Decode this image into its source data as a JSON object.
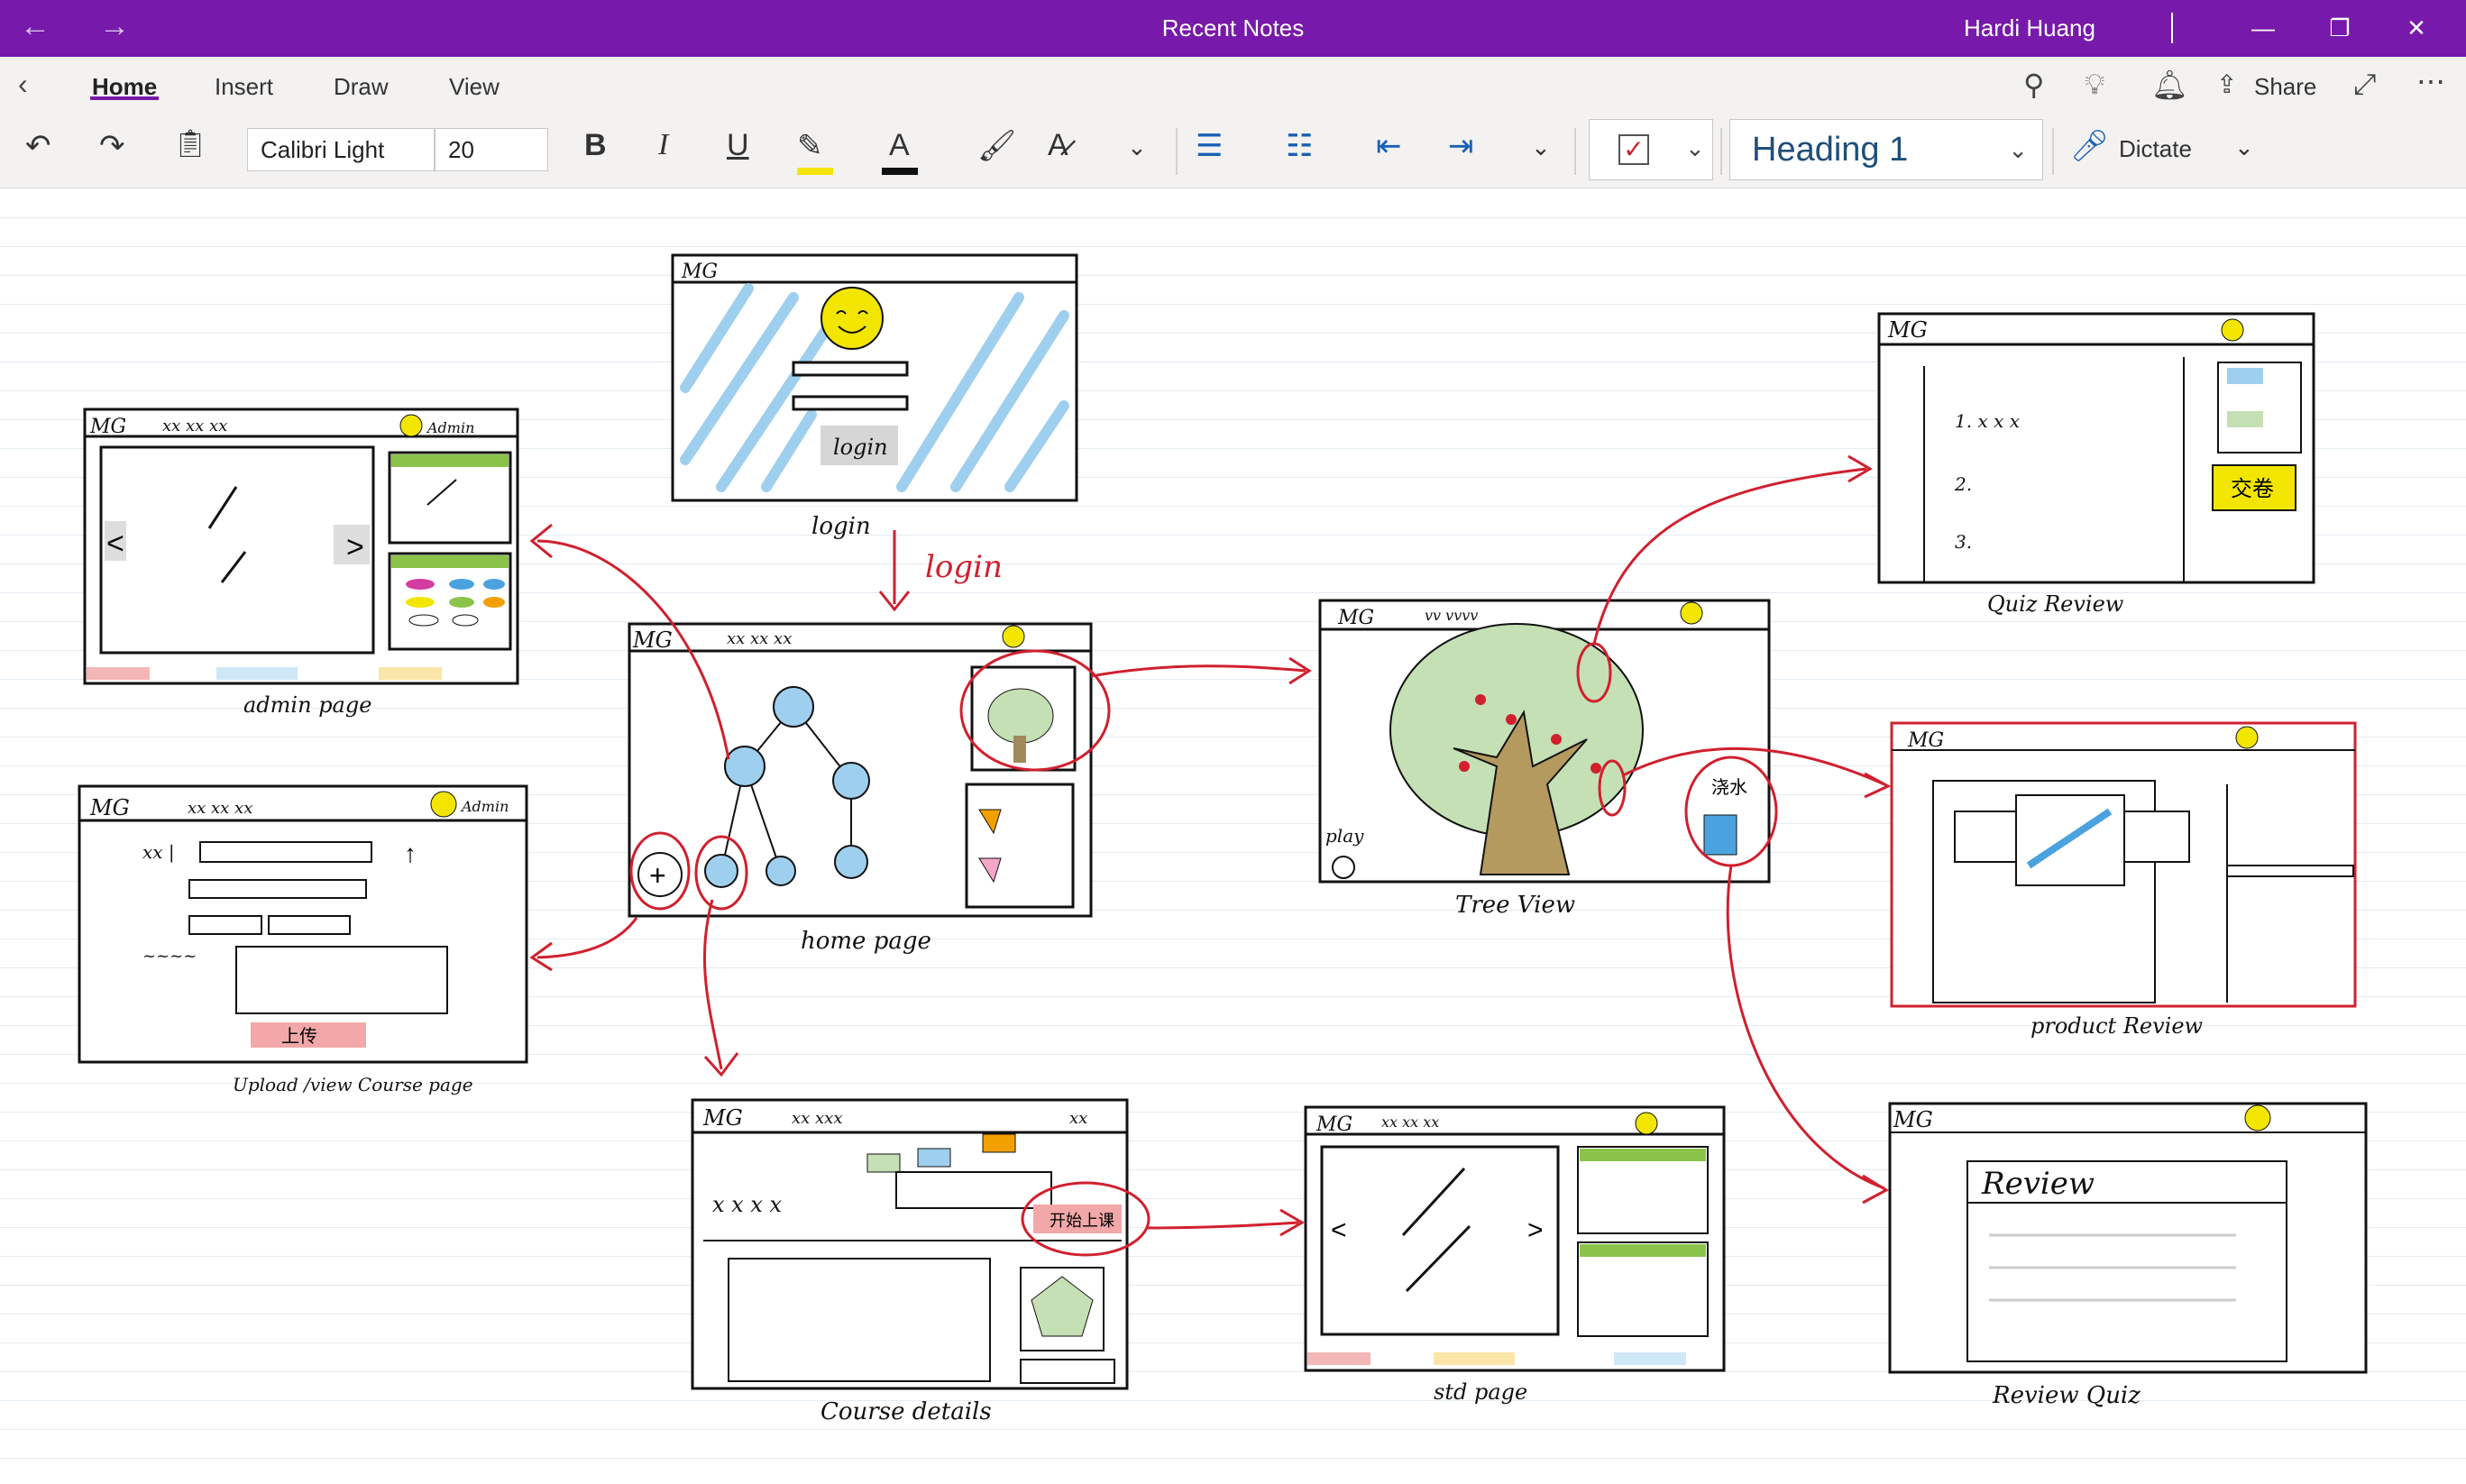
{
  "window": {
    "title": "Recent Notes",
    "user": "Hardi Huang",
    "back_icon": "back-arrow-icon",
    "forward_icon": "forward-arrow-icon"
  },
  "tabs": [
    {
      "label": "Home",
      "active": true
    },
    {
      "label": "Insert",
      "active": false
    },
    {
      "label": "Draw",
      "active": false
    },
    {
      "label": "View",
      "active": false
    }
  ],
  "top_right": {
    "share_label": "Share"
  },
  "ribbon": {
    "font_family": "Calibri Light",
    "font_size": "20",
    "bold": "B",
    "italic": "I",
    "underline": "U",
    "font_color_glyph": "A",
    "style": "Heading 1",
    "dictate_label": "Dictate"
  },
  "colors": {
    "titlebar": "#7719AA",
    "ink_red": "#d0202e",
    "ink_black": "#111111",
    "sketch_blue": "#9fcfee",
    "sketch_yellow": "#f2e600",
    "sketch_green": "#8bc34a"
  },
  "sketches": {
    "login_label": "login",
    "login_arrow_label": "login",
    "login_button": "login",
    "admin_label": "admin page",
    "admin_badge": "Admin",
    "upload_label": "Upload /view Course page",
    "upload_badge": "Admin",
    "upload_button": "上传",
    "home_label": "home page",
    "tree_label": "Tree  View",
    "tree_play": "play",
    "tree_water": "浇水",
    "quiz_label": "Quiz  Review",
    "quiz_submit": "交卷",
    "product_label": "product  Review",
    "course_label": "Course details",
    "course_enroll": "开始上课",
    "std_label": "std page",
    "review_quiz_label": "Review  Quiz",
    "review_heading": "Review",
    "logo": "MG"
  }
}
